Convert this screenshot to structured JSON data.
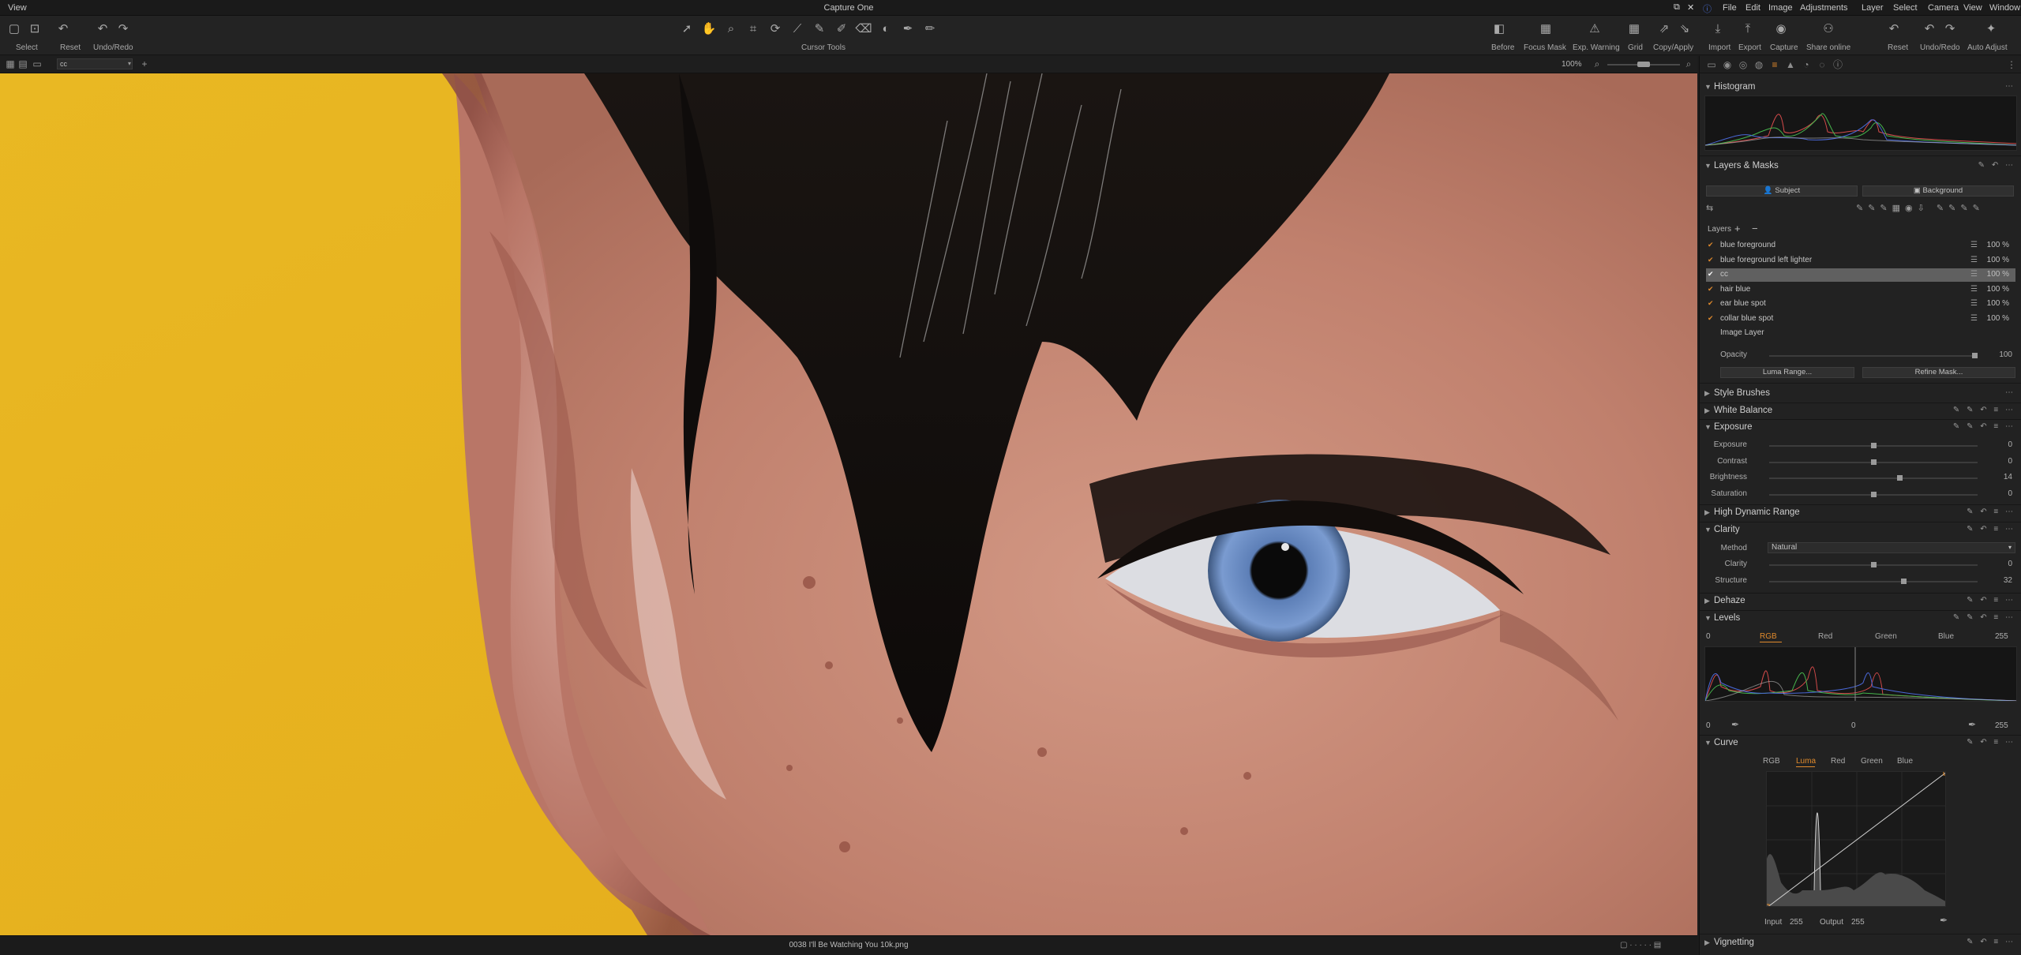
{
  "app": {
    "window_title": "Capture One",
    "view_menu": "View",
    "menu": [
      "File",
      "Edit",
      "Image",
      "Adjustments",
      "Layer",
      "Select",
      "Camera",
      "View",
      "Window"
    ]
  },
  "toolbar": {
    "left": [
      {
        "label": "Select",
        "icon": "select-icon"
      },
      {
        "label": "Reset",
        "icon": "reset-icon"
      },
      {
        "label": "Undo/Redo",
        "icon": "undo-icon"
      }
    ],
    "cursor_tools_label": "Cursor Tools",
    "right": [
      {
        "label": "Before",
        "icon": "before-icon"
      },
      {
        "label": "Focus Mask",
        "icon": "focus-mask-icon"
      },
      {
        "label": "Exp. Warning",
        "icon": "warning-icon"
      },
      {
        "label": "Grid",
        "icon": "grid-icon"
      },
      {
        "label": "Copy/Apply",
        "icon": "copy-apply-icon"
      },
      {
        "label": "Import",
        "icon": "import-icon"
      },
      {
        "label": "Export",
        "icon": "export-icon"
      },
      {
        "label": "Capture",
        "icon": "camera-icon"
      },
      {
        "label": "Share online",
        "icon": "share-icon"
      },
      {
        "label": "Reset",
        "icon": "reset-icon"
      },
      {
        "label": "Undo/Redo",
        "icon": "undo-icon"
      },
      {
        "label": "Auto Adjust",
        "icon": "auto-adjust-icon"
      }
    ]
  },
  "subbar": {
    "layer_select": "cc",
    "zoom": "100%"
  },
  "status": {
    "filename": "0038 I'll Be Watching You 10k.png"
  },
  "panel": {
    "histogram_title": "Histogram",
    "layers_masks_title": "Layers & Masks",
    "subject_btn": "Subject",
    "background_btn": "Background",
    "layers_label": "Layers",
    "layers": [
      {
        "name": "blue foreground",
        "opacity": "100 %",
        "checked": true,
        "selected": false
      },
      {
        "name": "blue foreground left lighter",
        "opacity": "100 %",
        "checked": true,
        "selected": false
      },
      {
        "name": "cc",
        "opacity": "100 %",
        "checked": true,
        "selected": true
      },
      {
        "name": "hair blue",
        "opacity": "100 %",
        "checked": true,
        "selected": false
      },
      {
        "name": "ear blue spot",
        "opacity": "100 %",
        "checked": true,
        "selected": false
      },
      {
        "name": "collar blue spot",
        "opacity": "100 %",
        "checked": true,
        "selected": false
      },
      {
        "name": "Image Layer",
        "opacity": "",
        "checked": false,
        "selected": false
      }
    ],
    "opacity_label": "Opacity",
    "opacity_value": "100",
    "opacity_level": 1.0,
    "luma_range_btn": "Luma Range...",
    "refine_mask_btn": "Refine Mask...",
    "style_brushes": "Style Brushes",
    "white_balance": "White Balance",
    "exposure": {
      "title": "Exposure",
      "rows": [
        {
          "label": "Exposure",
          "value": "0",
          "level": 0.5
        },
        {
          "label": "Contrast",
          "value": "0",
          "level": 0.5
        },
        {
          "label": "Brightness",
          "value": "14",
          "level": 0.63
        },
        {
          "label": "Saturation",
          "value": "0",
          "level": 0.5
        }
      ]
    },
    "hdr": "High Dynamic Range",
    "clarity": {
      "title": "Clarity",
      "method_label": "Method",
      "method_value": "Natural",
      "rows": [
        {
          "label": "Clarity",
          "value": "0",
          "level": 0.5
        },
        {
          "label": "Structure",
          "value": "32",
          "level": 0.65
        }
      ]
    },
    "dehaze": "Dehaze",
    "levels": {
      "title": "Levels",
      "left_value": "0",
      "right_value": "255",
      "tabs": [
        "RGB",
        "Red",
        "Green",
        "Blue"
      ],
      "active_tab": "RGB",
      "bottom_left": "0",
      "bottom_mid": "0",
      "bottom_right": "255"
    },
    "curve": {
      "title": "Curve",
      "tabs": [
        "RGB",
        "Luma",
        "Red",
        "Green",
        "Blue"
      ],
      "active_tab": "Luma",
      "input_label": "Input",
      "input_value": "255",
      "output_label": "Output",
      "output_value": "255"
    },
    "vignetting": "Vignetting"
  },
  "colors": {
    "accent": "#e08a2c",
    "background_yellow": "#e5b21f",
    "skin": "#c98a78"
  }
}
